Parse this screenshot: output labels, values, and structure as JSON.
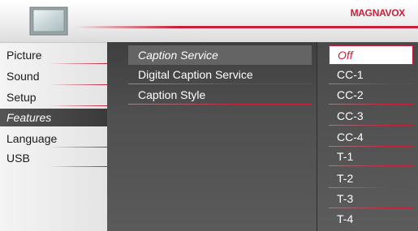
{
  "header": {
    "brand": "MAGNAVOX",
    "icon": "tv-screen-icon",
    "accent_color": "#c8203a"
  },
  "menu": {
    "items": [
      {
        "label": "Picture"
      },
      {
        "label": "Sound"
      },
      {
        "label": "Setup"
      },
      {
        "label": "Features",
        "selected": true
      },
      {
        "label": "Language"
      },
      {
        "label": "USB"
      }
    ]
  },
  "submenu": {
    "items": [
      {
        "label": "Caption Service",
        "selected": true
      },
      {
        "label": "Digital Caption Service"
      },
      {
        "label": "Caption Style"
      }
    ]
  },
  "options": {
    "items": [
      {
        "label": "Off",
        "selected": true
      },
      {
        "label": "CC-1"
      },
      {
        "label": "CC-2"
      },
      {
        "label": "CC-3"
      },
      {
        "label": "CC-4"
      },
      {
        "label": "T-1"
      },
      {
        "label": "T-2"
      },
      {
        "label": "T-3"
      },
      {
        "label": "T-4"
      }
    ]
  }
}
